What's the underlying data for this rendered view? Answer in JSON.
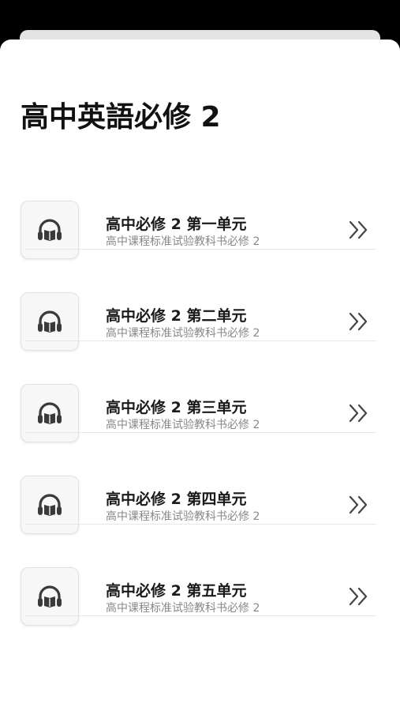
{
  "page": {
    "title": "高中英語必修 2"
  },
  "units": [
    {
      "title": "高中必修 2 第一单元",
      "subtitle": "高中课程标准试验教科书必修 2",
      "icon": "headphones-book-icon",
      "action_icon": "double-chevron-right-icon"
    },
    {
      "title": "高中必修 2 第二单元",
      "subtitle": "高中课程标准试验教科书必修 2",
      "icon": "headphones-book-icon",
      "action_icon": "double-chevron-right-icon"
    },
    {
      "title": "高中必修 2 第三单元",
      "subtitle": "高中课程标准试验教科书必修 2",
      "icon": "headphones-book-icon",
      "action_icon": "double-chevron-right-icon"
    },
    {
      "title": "高中必修 2 第四单元",
      "subtitle": "高中课程标准试验教科书必修 2",
      "icon": "headphones-book-icon",
      "action_icon": "double-chevron-right-icon"
    },
    {
      "title": "高中必修 2 第五单元",
      "subtitle": "高中课程标准试验教科书必修 2",
      "icon": "headphones-book-icon",
      "action_icon": "double-chevron-right-icon"
    }
  ],
  "colors": {
    "background": "#000000",
    "sheet": "#ffffff",
    "title_text": "#111111",
    "subtitle_text": "#888888",
    "icon": "#3a3a3a"
  }
}
